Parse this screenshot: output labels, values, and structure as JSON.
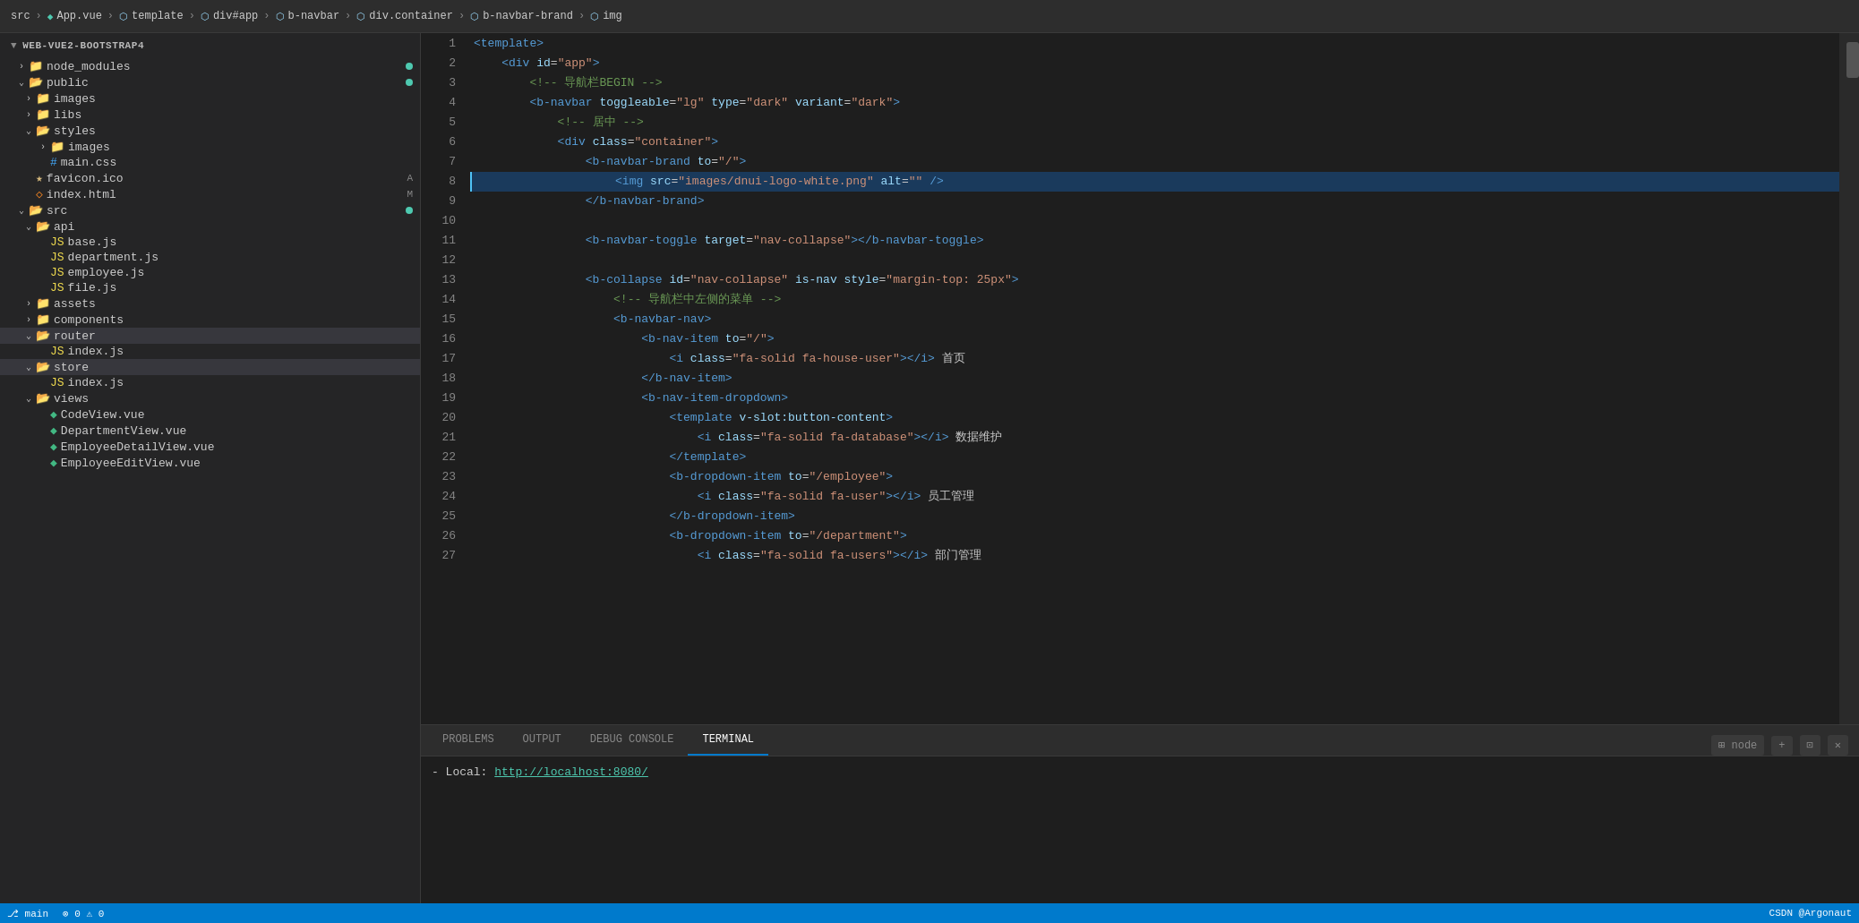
{
  "window": {
    "title": "WEB-VUE2-BOOTSTRAP4"
  },
  "breadcrumb": {
    "items": [
      {
        "label": "src",
        "type": "text"
      },
      {
        "label": ">",
        "type": "sep"
      },
      {
        "label": "App.vue",
        "type": "vue"
      },
      {
        "label": ">",
        "type": "sep"
      },
      {
        "label": "template",
        "type": "div"
      },
      {
        "label": ">",
        "type": "sep"
      },
      {
        "label": "div#app",
        "type": "div"
      },
      {
        "label": ">",
        "type": "sep"
      },
      {
        "label": "b-navbar",
        "type": "div"
      },
      {
        "label": ">",
        "type": "sep"
      },
      {
        "label": "div.container",
        "type": "div"
      },
      {
        "label": ">",
        "type": "sep"
      },
      {
        "label": "b-navbar-brand",
        "type": "div"
      },
      {
        "label": ">",
        "type": "sep"
      },
      {
        "label": "img",
        "type": "div"
      }
    ]
  },
  "sidebar": {
    "title": "WEB-VUE2-BOOTSTRAP4",
    "tree": [
      {
        "id": "node_modules",
        "label": "node_modules",
        "type": "folder",
        "indent": 1,
        "expanded": false,
        "badge": "dot-green"
      },
      {
        "id": "public",
        "label": "public",
        "type": "folder",
        "indent": 1,
        "expanded": true,
        "badge": "dot-green"
      },
      {
        "id": "images",
        "label": "images",
        "type": "folder",
        "indent": 2,
        "expanded": false
      },
      {
        "id": "libs",
        "label": "libs",
        "type": "folder",
        "indent": 2,
        "expanded": false
      },
      {
        "id": "styles",
        "label": "styles",
        "type": "folder",
        "indent": 2,
        "expanded": true
      },
      {
        "id": "styles-images",
        "label": "images",
        "type": "folder",
        "indent": 3,
        "expanded": false
      },
      {
        "id": "main-css",
        "label": "main.css",
        "type": "css",
        "indent": 3
      },
      {
        "id": "favicon",
        "label": "favicon.ico",
        "type": "ico",
        "indent": 2,
        "badge": "A"
      },
      {
        "id": "index-html",
        "label": "index.html",
        "type": "html",
        "indent": 2,
        "badge": "M"
      },
      {
        "id": "src",
        "label": "src",
        "type": "folder",
        "indent": 1,
        "expanded": true,
        "badge": "dot-green"
      },
      {
        "id": "api",
        "label": "api",
        "type": "folder",
        "indent": 2,
        "expanded": true
      },
      {
        "id": "base-js",
        "label": "base.js",
        "type": "js",
        "indent": 3
      },
      {
        "id": "department-js",
        "label": "department.js",
        "type": "js",
        "indent": 3
      },
      {
        "id": "employee-js",
        "label": "employee.js",
        "type": "js",
        "indent": 3
      },
      {
        "id": "file-js",
        "label": "file.js",
        "type": "js",
        "indent": 3
      },
      {
        "id": "assets",
        "label": "assets",
        "type": "folder",
        "indent": 2,
        "expanded": false
      },
      {
        "id": "components",
        "label": "components",
        "type": "folder",
        "indent": 2,
        "expanded": false
      },
      {
        "id": "router",
        "label": "router",
        "type": "folder",
        "indent": 2,
        "expanded": true
      },
      {
        "id": "router-index",
        "label": "index.js",
        "type": "js",
        "indent": 3
      },
      {
        "id": "store",
        "label": "store",
        "type": "folder",
        "indent": 2,
        "expanded": true,
        "active": true
      },
      {
        "id": "store-index",
        "label": "index.js",
        "type": "js",
        "indent": 3
      },
      {
        "id": "views",
        "label": "views",
        "type": "folder",
        "indent": 2,
        "expanded": true
      },
      {
        "id": "code-view",
        "label": "CodeView.vue",
        "type": "vue",
        "indent": 3
      },
      {
        "id": "dept-view",
        "label": "DepartmentView.vue",
        "type": "vue",
        "indent": 3
      },
      {
        "id": "emp-detail",
        "label": "EmployeeDetailView.vue",
        "type": "vue",
        "indent": 3
      },
      {
        "id": "emp-edit",
        "label": "EmployeeEditView.vue",
        "type": "vue",
        "indent": 3
      }
    ]
  },
  "editor": {
    "lines": [
      {
        "num": 1,
        "tokens": [
          {
            "t": "<template>",
            "c": "syn-tag"
          }
        ]
      },
      {
        "num": 2,
        "tokens": [
          {
            "t": "    <div ",
            "c": "syn-tag"
          },
          {
            "t": "id",
            "c": "syn-attr"
          },
          {
            "t": "=",
            "c": "syn-eq"
          },
          {
            "t": "\"app\"",
            "c": "syn-val"
          },
          {
            "t": ">",
            "c": "syn-tag"
          }
        ]
      },
      {
        "num": 3,
        "tokens": [
          {
            "t": "        <!-- ",
            "c": "syn-comment"
          },
          {
            "t": "导航栏BEGIN",
            "c": "syn-comment"
          },
          {
            "t": " -->",
            "c": "syn-comment"
          }
        ]
      },
      {
        "num": 4,
        "tokens": [
          {
            "t": "        <b-navbar ",
            "c": "syn-tag"
          },
          {
            "t": "toggleable",
            "c": "syn-attr"
          },
          {
            "t": "=",
            "c": "syn-eq"
          },
          {
            "t": "\"lg\"",
            "c": "syn-val"
          },
          {
            "t": " type",
            "c": "syn-attr"
          },
          {
            "t": "=",
            "c": "syn-eq"
          },
          {
            "t": "\"dark\"",
            "c": "syn-val"
          },
          {
            "t": " variant",
            "c": "syn-attr"
          },
          {
            "t": "=",
            "c": "syn-eq"
          },
          {
            "t": "\"dark\"",
            "c": "syn-val"
          },
          {
            "t": ">",
            "c": "syn-tag"
          }
        ]
      },
      {
        "num": 5,
        "tokens": [
          {
            "t": "            <!-- ",
            "c": "syn-comment"
          },
          {
            "t": "居中",
            "c": "syn-comment"
          },
          {
            "t": " -->",
            "c": "syn-comment"
          }
        ]
      },
      {
        "num": 6,
        "tokens": [
          {
            "t": "            <div ",
            "c": "syn-tag"
          },
          {
            "t": "class",
            "c": "syn-attr"
          },
          {
            "t": "=",
            "c": "syn-eq"
          },
          {
            "t": "\"container\"",
            "c": "syn-val"
          },
          {
            "t": ">",
            "c": "syn-tag"
          }
        ]
      },
      {
        "num": 7,
        "tokens": [
          {
            "t": "                <b-navbar-brand ",
            "c": "syn-tag"
          },
          {
            "t": "to",
            "c": "syn-attr"
          },
          {
            "t": "=",
            "c": "syn-eq"
          },
          {
            "t": "\"/\"",
            "c": "syn-val"
          },
          {
            "t": ">",
            "c": "syn-tag"
          }
        ]
      },
      {
        "num": 8,
        "tokens": [
          {
            "t": "                    <img ",
            "c": "syn-tag"
          },
          {
            "t": "src",
            "c": "syn-attr"
          },
          {
            "t": "=",
            "c": "syn-eq"
          },
          {
            "t": "\"images/dnui-logo-white.png\"",
            "c": "syn-val"
          },
          {
            "t": " alt",
            "c": "syn-attr"
          },
          {
            "t": "=",
            "c": "syn-eq"
          },
          {
            "t": "\"\"",
            "c": "syn-val"
          },
          {
            "t": " />",
            "c": "syn-tag"
          }
        ],
        "current": true
      },
      {
        "num": 9,
        "tokens": [
          {
            "t": "                </b-navbar-brand>",
            "c": "syn-tag"
          }
        ]
      },
      {
        "num": 10,
        "tokens": []
      },
      {
        "num": 11,
        "tokens": [
          {
            "t": "                <b-navbar-toggle ",
            "c": "syn-tag"
          },
          {
            "t": "target",
            "c": "syn-attr"
          },
          {
            "t": "=",
            "c": "syn-eq"
          },
          {
            "t": "\"nav-collapse\"",
            "c": "syn-val"
          },
          {
            "t": "></b-navbar-toggle>",
            "c": "syn-tag"
          }
        ]
      },
      {
        "num": 12,
        "tokens": []
      },
      {
        "num": 13,
        "tokens": [
          {
            "t": "                <b-collapse ",
            "c": "syn-tag"
          },
          {
            "t": "id",
            "c": "syn-attr"
          },
          {
            "t": "=",
            "c": "syn-eq"
          },
          {
            "t": "\"nav-collapse\"",
            "c": "syn-val"
          },
          {
            "t": " is-nav ",
            "c": "syn-attr"
          },
          {
            "t": "style",
            "c": "syn-attr"
          },
          {
            "t": "=",
            "c": "syn-eq"
          },
          {
            "t": "\"margin-top: 25px\"",
            "c": "syn-val"
          },
          {
            "t": ">",
            "c": "syn-tag"
          }
        ]
      },
      {
        "num": 14,
        "tokens": [
          {
            "t": "                    <!-- ",
            "c": "syn-comment"
          },
          {
            "t": "导航栏中左侧的菜单",
            "c": "syn-comment"
          },
          {
            "t": " -->",
            "c": "syn-comment"
          }
        ]
      },
      {
        "num": 15,
        "tokens": [
          {
            "t": "                    <b-navbar-nav>",
            "c": "syn-tag"
          }
        ]
      },
      {
        "num": 16,
        "tokens": [
          {
            "t": "                        <b-nav-item ",
            "c": "syn-tag"
          },
          {
            "t": "to",
            "c": "syn-attr"
          },
          {
            "t": "=",
            "c": "syn-eq"
          },
          {
            "t": "\"/\"",
            "c": "syn-val"
          },
          {
            "t": ">",
            "c": "syn-tag"
          }
        ]
      },
      {
        "num": 17,
        "tokens": [
          {
            "t": "                            <i ",
            "c": "syn-tag"
          },
          {
            "t": "class",
            "c": "syn-attr"
          },
          {
            "t": "=",
            "c": "syn-eq"
          },
          {
            "t": "\"fa-solid fa-house-user\"",
            "c": "syn-val"
          },
          {
            "t": "></i> ",
            "c": "syn-tag"
          },
          {
            "t": "首页",
            "c": "syn-chinese"
          }
        ]
      },
      {
        "num": 18,
        "tokens": [
          {
            "t": "                        </b-nav-item>",
            "c": "syn-tag"
          }
        ]
      },
      {
        "num": 19,
        "tokens": [
          {
            "t": "                        <b-nav-item-dropdown>",
            "c": "syn-tag"
          }
        ]
      },
      {
        "num": 20,
        "tokens": [
          {
            "t": "                            <template ",
            "c": "syn-tag"
          },
          {
            "t": "v-slot:button-content",
            "c": "syn-attr"
          },
          {
            "t": ">",
            "c": "syn-tag"
          }
        ]
      },
      {
        "num": 21,
        "tokens": [
          {
            "t": "                                <i ",
            "c": "syn-tag"
          },
          {
            "t": "class",
            "c": "syn-attr"
          },
          {
            "t": "=",
            "c": "syn-eq"
          },
          {
            "t": "\"fa-solid fa-database\"",
            "c": "syn-val"
          },
          {
            "t": "></i> ",
            "c": "syn-tag"
          },
          {
            "t": "数据维护",
            "c": "syn-chinese"
          }
        ]
      },
      {
        "num": 22,
        "tokens": [
          {
            "t": "                            </template>",
            "c": "syn-tag"
          }
        ]
      },
      {
        "num": 23,
        "tokens": [
          {
            "t": "                            <b-dropdown-item ",
            "c": "syn-tag"
          },
          {
            "t": "to",
            "c": "syn-attr"
          },
          {
            "t": "=",
            "c": "syn-eq"
          },
          {
            "t": "\"/employee\"",
            "c": "syn-val"
          },
          {
            "t": ">",
            "c": "syn-tag"
          }
        ]
      },
      {
        "num": 24,
        "tokens": [
          {
            "t": "                                <i ",
            "c": "syn-tag"
          },
          {
            "t": "class",
            "c": "syn-attr"
          },
          {
            "t": "=",
            "c": "syn-eq"
          },
          {
            "t": "\"fa-solid fa-user\"",
            "c": "syn-val"
          },
          {
            "t": "></i> ",
            "c": "syn-tag"
          },
          {
            "t": "员工管理",
            "c": "syn-chinese"
          }
        ]
      },
      {
        "num": 25,
        "tokens": [
          {
            "t": "                            </b-dropdown-item>",
            "c": "syn-tag"
          }
        ]
      },
      {
        "num": 26,
        "tokens": [
          {
            "t": "                            <b-dropdown-item ",
            "c": "syn-tag"
          },
          {
            "t": "to",
            "c": "syn-eq"
          },
          {
            "t": "=",
            "c": "syn-eq"
          },
          {
            "t": "\"/department\"",
            "c": "syn-val"
          },
          {
            "t": ">",
            "c": "syn-tag"
          }
        ]
      },
      {
        "num": 27,
        "tokens": [
          {
            "t": "                                <i ",
            "c": "syn-tag"
          },
          {
            "t": "class",
            "c": "syn-attr"
          },
          {
            "t": "=",
            "c": "syn-eq"
          },
          {
            "t": "\"fa-solid fa-users\"",
            "c": "syn-val"
          },
          {
            "t": "></i> ",
            "c": "syn-tag"
          },
          {
            "t": "部门管理",
            "c": "syn-chinese"
          }
        ]
      }
    ]
  },
  "panel": {
    "tabs": [
      {
        "label": "PROBLEMS",
        "active": false
      },
      {
        "label": "OUTPUT",
        "active": false
      },
      {
        "label": "DEBUG CONSOLE",
        "active": false
      },
      {
        "label": "TERMINAL",
        "active": true
      }
    ],
    "terminal_actions": [
      {
        "label": "⊞ node",
        "id": "node-action"
      },
      {
        "label": "+",
        "id": "add-terminal"
      },
      {
        "label": "⊡",
        "id": "split-terminal"
      },
      {
        "label": "✕",
        "id": "close-terminal"
      }
    ],
    "terminal_content": [
      {
        "text": "  - Local:   ",
        "link": "http://localhost:8080/",
        "link_text": "http://localhost:8080/"
      }
    ]
  },
  "status_bar": {
    "right_items": [
      "CSDN @Argonaut"
    ]
  }
}
